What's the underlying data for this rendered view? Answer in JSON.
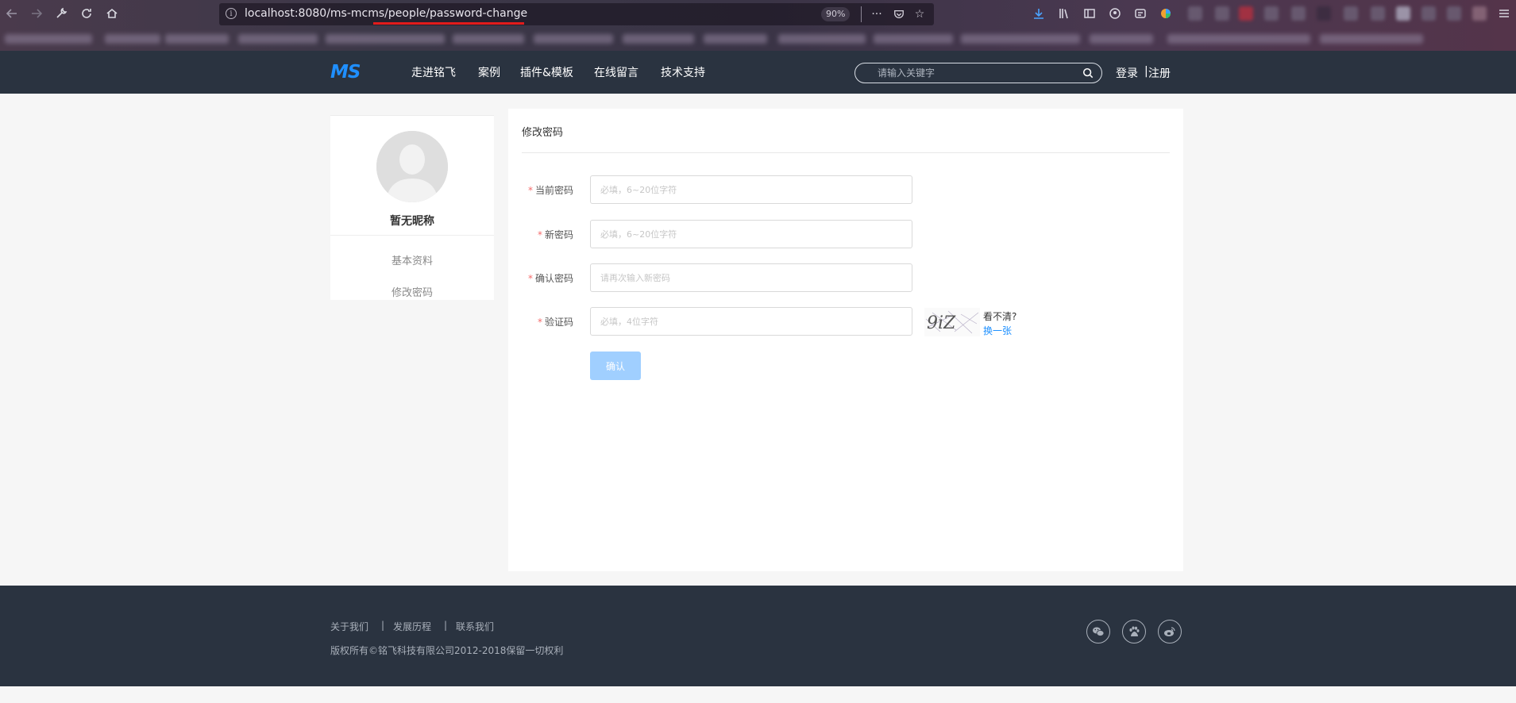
{
  "browser": {
    "url": "localhost:8080/ms-mcms/people/password-change",
    "zoom": "90%",
    "url_more": "···"
  },
  "header": {
    "logo": "MS",
    "nav": [
      "走进铭飞",
      "案例",
      "插件&模板",
      "在线留言",
      "技术支持"
    ],
    "search_placeholder": "请输入关键字",
    "login": "登录",
    "separator": "|",
    "register": "注册"
  },
  "sidebar": {
    "nickname": "暂无昵称",
    "links": [
      "基本资料",
      "修改密码"
    ]
  },
  "form": {
    "title": "修改密码",
    "required_mark": "*",
    "fields": [
      {
        "label": "当前密码",
        "placeholder": "必填，6~20位字符"
      },
      {
        "label": "新密码",
        "placeholder": "必填，6~20位字符"
      },
      {
        "label": "确认密码",
        "placeholder": "请再次输入新密码"
      },
      {
        "label": "验证码",
        "placeholder": "必填，4位字符"
      }
    ],
    "captcha_text": "9iZ",
    "captcha_unclear": "看不清?",
    "captcha_refresh": "换一张",
    "submit": "确认"
  },
  "footer": {
    "links": [
      "关于我们",
      "发展历程",
      "联系我们"
    ],
    "separator": "|",
    "copyright": "版权所有©铭飞科技有限公司2012-2018保留一切权利",
    "social": [
      "wechat-icon",
      "baidu-icon",
      "weibo-icon"
    ]
  },
  "colors": {
    "header_bg": "#2a3340",
    "accent": "#1f8fff",
    "button_disabled": "#a0cfff",
    "required": "#f56c6c",
    "underline": "#e21b1b"
  }
}
